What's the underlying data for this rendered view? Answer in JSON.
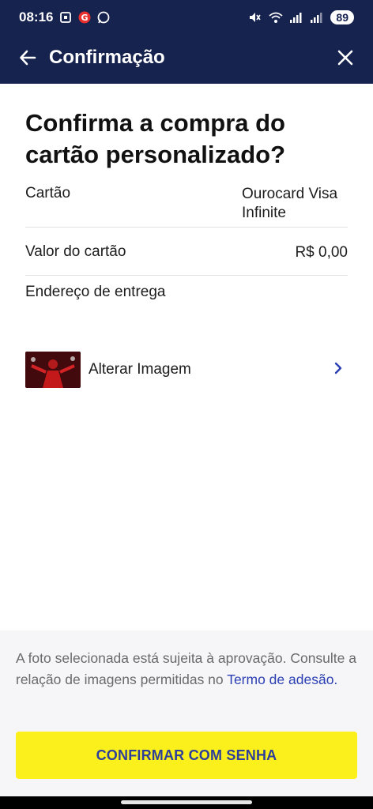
{
  "status": {
    "time": "08:16",
    "battery": "89",
    "icons": [
      "screenshot-icon",
      "g-app-icon",
      "whatsapp-icon",
      "mute-icon",
      "wifi-icon",
      "signal-icon",
      "signal-icon-2"
    ]
  },
  "appbar": {
    "title": "Confirmação",
    "back_icon": "arrow-left-icon",
    "close_icon": "close-icon"
  },
  "main": {
    "title": "Confirma a compra do cartão personalizado?",
    "rows": [
      {
        "label": "Cartão",
        "value": "Ourocard Visa Infinite"
      },
      {
        "label": "Valor do cartão",
        "value": "R$ 0,00"
      },
      {
        "label": "Endereço de entrega",
        "value": ""
      }
    ],
    "image_action": "Alterar Imagem"
  },
  "footer": {
    "note": "A foto selecionada está sujeita à aprovação. Consulte a relação de imagens permitidas no",
    "link": "Termo de adesão.",
    "confirm_button": "CONFIRMAR COM SENHA"
  },
  "colors": {
    "header_bg": "#16234f",
    "button_bg": "#fbf01c",
    "button_text": "#2e3f9a",
    "link": "#2b3fb3"
  }
}
